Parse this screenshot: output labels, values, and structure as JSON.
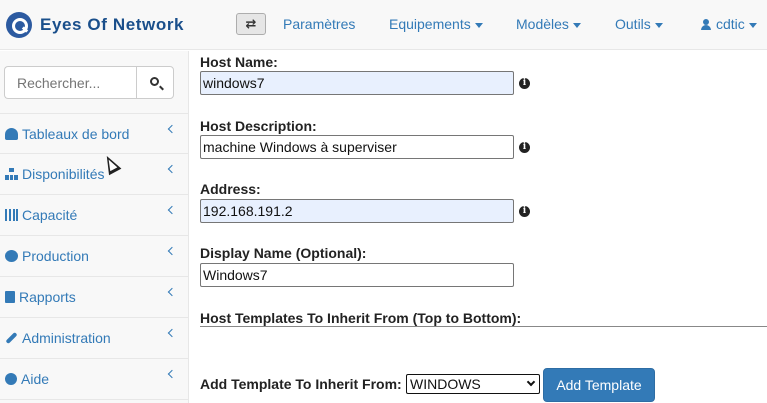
{
  "brand": {
    "name": "Eyes Of Network"
  },
  "navbar": {
    "links": [
      {
        "label": "Paramètres",
        "dropdown": false
      },
      {
        "label": "Equipements",
        "dropdown": true
      },
      {
        "label": "Modèles",
        "dropdown": true
      },
      {
        "label": "Outils",
        "dropdown": true
      }
    ],
    "user": "cdtic",
    "toggle_icon": "⇄"
  },
  "sidebar": {
    "search_placeholder": "Rechercher...",
    "items": [
      {
        "label": "Tableaux de bord",
        "icon": "dashboard-icon"
      },
      {
        "label": "Disponibilités",
        "icon": "sitemap-icon"
      },
      {
        "label": "Capacité",
        "icon": "bar-chart-icon"
      },
      {
        "label": "Production",
        "icon": "cogs-icon"
      },
      {
        "label": "Rapports",
        "icon": "file-icon"
      },
      {
        "label": "Administration",
        "icon": "wrench-icon"
      },
      {
        "label": "Aide",
        "icon": "question-circle-icon"
      }
    ]
  },
  "form": {
    "host_name_label": "Host Name:",
    "host_name_value": "windows7",
    "host_description_label": "Host Description:",
    "host_description_value": "machine Windows à superviser",
    "address_label": "Address:",
    "address_value": "192.168.191.2",
    "display_name_label": "Display Name (Optional):",
    "display_name_value": "Windows7",
    "templates_heading": "Host Templates To Inherit From (Top to Bottom):",
    "add_template_label": "Add Template To Inherit From:",
    "template_selected": "WINDOWS",
    "add_template_button": "Add Template",
    "info_glyph": "i"
  },
  "colors": {
    "link": "#337ab7",
    "autofill": "#e8f0fe",
    "button": "#337ab7"
  }
}
